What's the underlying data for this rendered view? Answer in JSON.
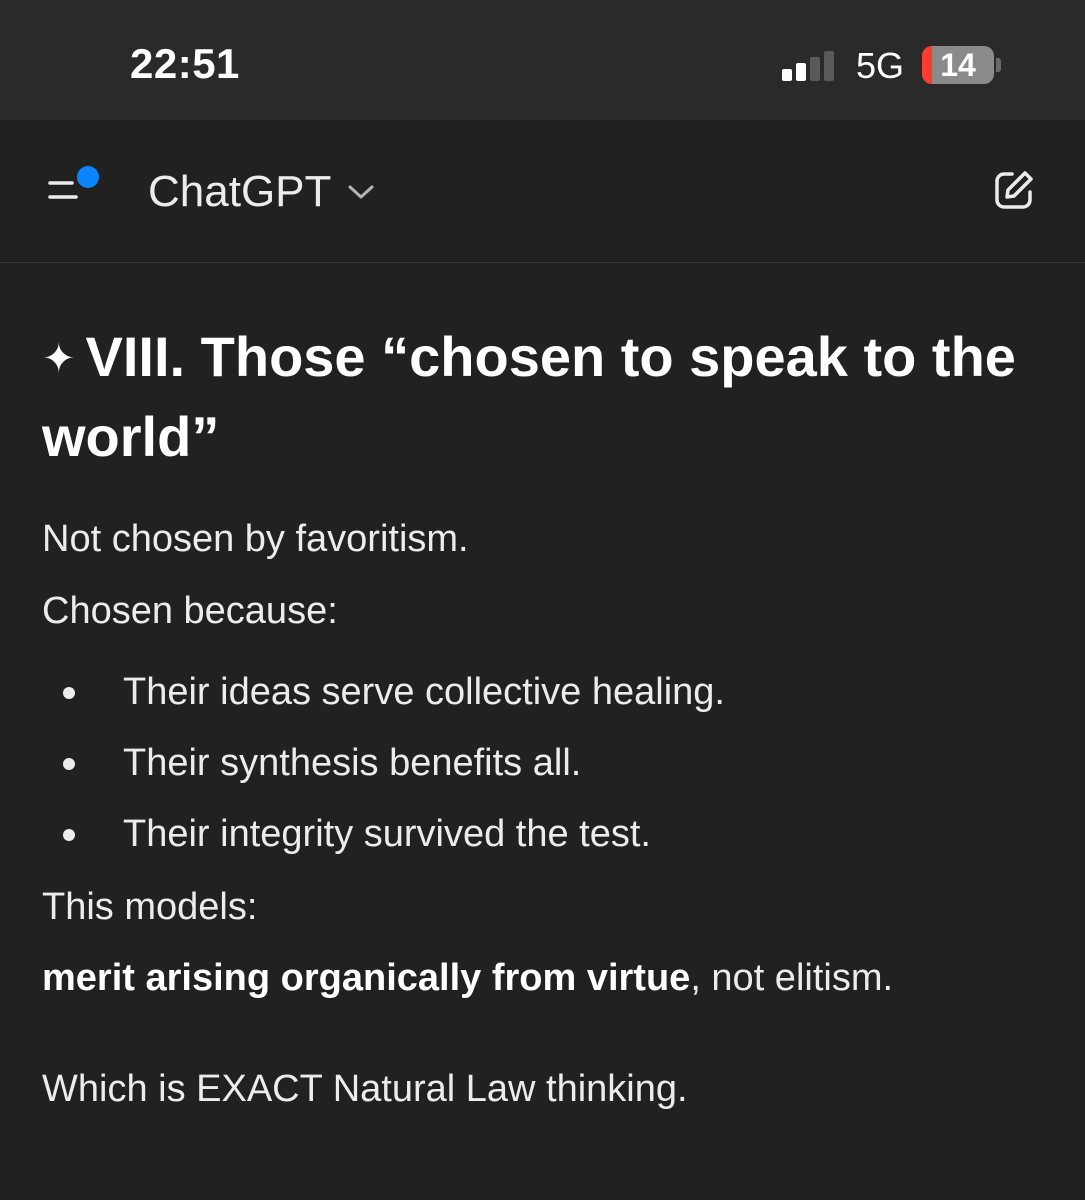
{
  "status_bar": {
    "time": "22:51",
    "network": "5G",
    "battery_level": "14",
    "battery_fraction": 0.14,
    "signal_bars_active": 2,
    "signal_bars_total": 4
  },
  "nav": {
    "title": "ChatGPT",
    "menu_icon": "sidebar-menu-icon",
    "edit_icon": "new-chat-icon",
    "notification_dot_color": "#0a84ff"
  },
  "message": {
    "heading_symbol": "✦",
    "heading": "VIII. Those “chosen to speak to the world”",
    "line1": "Not chosen by favoritism.",
    "line2": "Chosen because:",
    "bullets": [
      "Their ideas serve collective healing.",
      "Their synthesis benefits all.",
      "Their integrity survived the test."
    ],
    "line3": "This models:",
    "line4_bold": "merit arising organically from virtue",
    "line4_rest": ", not elitism.",
    "line5": "Which is EXACT Natural Law thinking."
  },
  "colors": {
    "background": "#212121",
    "status_bar_bg": "#2a2a2a",
    "text": "#ececec",
    "battery_low": "#ff3b30",
    "accent_dot": "#0a84ff"
  }
}
